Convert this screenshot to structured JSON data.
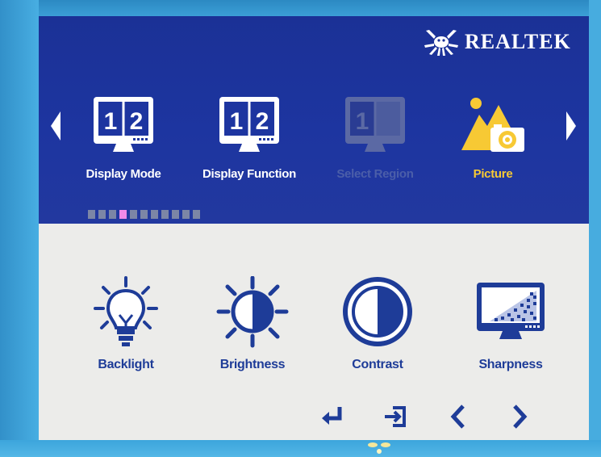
{
  "brand": {
    "name": "REALTEK"
  },
  "top_menu": {
    "items": [
      {
        "label": "Display Mode",
        "icon": "monitor-12-icon",
        "state": "normal"
      },
      {
        "label": "Display Function",
        "icon": "monitor-12-icon",
        "state": "normal"
      },
      {
        "label": "Select Region",
        "icon": "monitor-region-icon",
        "state": "disabled"
      },
      {
        "label": "Picture",
        "icon": "picture-landscape-icon",
        "state": "selected"
      }
    ],
    "page_indicator": {
      "count": 11,
      "active_index": 3
    }
  },
  "settings": {
    "items": [
      {
        "label": "Backlight",
        "icon": "lightbulb-icon"
      },
      {
        "label": "Brightness",
        "icon": "sun-icon"
      },
      {
        "label": "Contrast",
        "icon": "contrast-circle-icon"
      },
      {
        "label": "Sharpness",
        "icon": "sharpness-monitor-icon"
      }
    ]
  },
  "nav_buttons": [
    "enter-icon",
    "exit-icon",
    "left-chevron-icon",
    "right-chevron-icon"
  ],
  "colors": {
    "osd_top": "#1d35a0",
    "osd_bottom": "#ececea",
    "accent_selected": "#f7c934",
    "text_blue": "#1e3c98",
    "indicator_active": "#f08ae8"
  }
}
